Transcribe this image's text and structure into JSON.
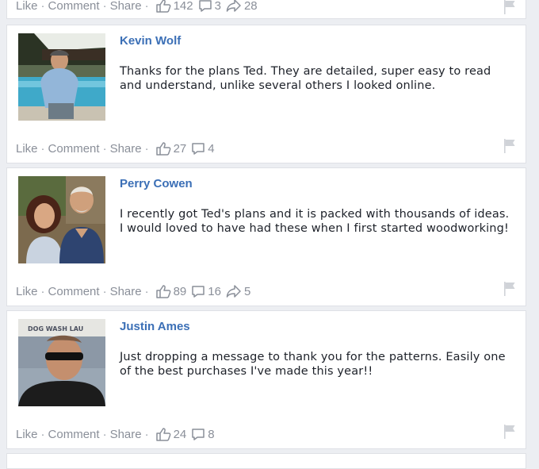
{
  "actions": {
    "like": "Like",
    "comment": "Comment",
    "share": "Share",
    "separator": "·"
  },
  "top_card": {
    "likes": "142",
    "comments": "3",
    "shares": "28"
  },
  "posts": [
    {
      "author": "Kevin Wolf",
      "text": "Thanks for the plans Ted. They are detailed, super easy to read and understand, unlike several others I looked online.",
      "likes": "27",
      "comments": "4"
    },
    {
      "author": "Perry Cowen",
      "text": "I recently got Ted's plans and it is packed with thousands of ideas. I would loved to have had these when I first started woodworking!",
      "likes": "89",
      "comments": "16",
      "shares": "5"
    },
    {
      "author": "Justin Ames",
      "text": "Just dropping a message to thank you for the patterns. Easily one of the best purchases I've made this year!!",
      "likes": "24",
      "comments": "8",
      "sign_text": "DOG WASH   LAU"
    }
  ],
  "colors": {
    "link": "#3b6fb6",
    "meta": "#8a8f99",
    "text": "#1d2129",
    "card_border": "#dfe1e6",
    "page_bg": "#eceef2"
  }
}
